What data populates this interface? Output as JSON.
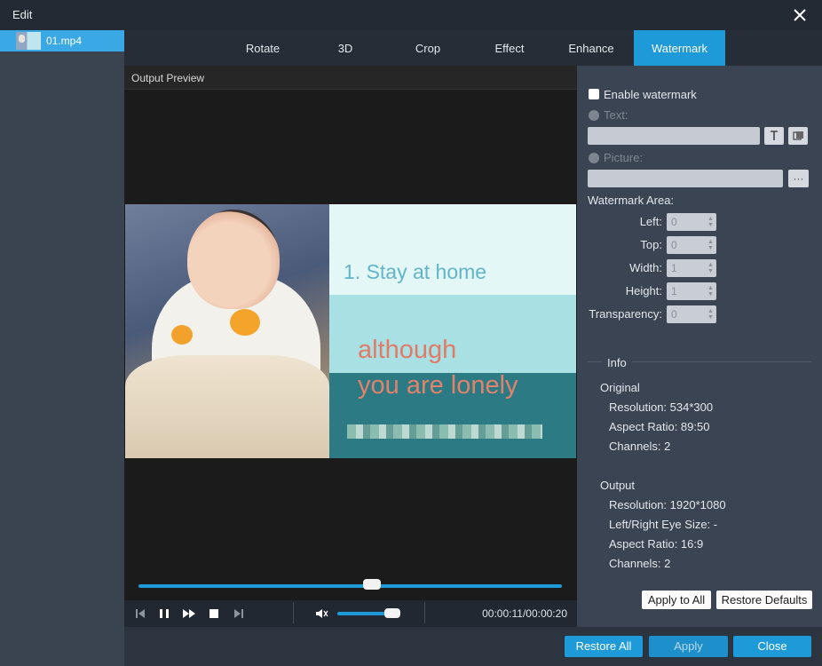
{
  "window": {
    "title": "Edit",
    "close_icon": "close-icon"
  },
  "files": [
    {
      "name": "01.mp4",
      "selected": true
    }
  ],
  "tabs": [
    {
      "label": "Rotate",
      "active": false
    },
    {
      "label": "3D",
      "active": false
    },
    {
      "label": "Crop",
      "active": false
    },
    {
      "label": "Effect",
      "active": false
    },
    {
      "label": "Enhance",
      "active": false
    },
    {
      "label": "Watermark",
      "active": true
    }
  ],
  "preview": {
    "label": "Output Preview",
    "video_text": {
      "line1": "1. Stay at home",
      "line2": "although",
      "line3": "you are lonely"
    },
    "playback_progress": 0.55
  },
  "player": {
    "volume_level": 1.0,
    "time": "00:00:11/00:00:20",
    "icons": [
      "skip-previous-icon",
      "pause-icon",
      "fast-forward-icon",
      "stop-icon",
      "skip-next-icon",
      "volume-icon"
    ]
  },
  "watermark": {
    "enable_label": "Enable watermark",
    "enabled": false,
    "text_label": "Text:",
    "text_value": "",
    "picture_label": "Picture:",
    "picture_value": "",
    "picture_browse": "···",
    "area_label": "Watermark Area:",
    "fields": [
      {
        "label": "Left:",
        "value": "0"
      },
      {
        "label": "Top:",
        "value": "0"
      },
      {
        "label": "Width:",
        "value": "1"
      },
      {
        "label": "Height:",
        "value": "1"
      },
      {
        "label": "Transparency:",
        "value": "0"
      }
    ]
  },
  "info": {
    "title": "Info",
    "original": {
      "label": "Original",
      "resolution": "Resolution: 534*300",
      "aspect": "Aspect Ratio: 89:50",
      "channels": "Channels: 2"
    },
    "output": {
      "label": "Output",
      "resolution": "Resolution: 1920*1080",
      "eye": "Left/Right Eye Size: -",
      "aspect": "Aspect Ratio: 16:9",
      "channels": "Channels: 2"
    }
  },
  "buttons": {
    "apply_all": "Apply to All",
    "restore_defaults": "Restore Defaults",
    "restore_all": "Restore All",
    "apply": "Apply",
    "close": "Close"
  },
  "colors": {
    "accent": "#1e9ad9",
    "panel": "#3a4452",
    "preview_bg": "#1b1b1b"
  }
}
